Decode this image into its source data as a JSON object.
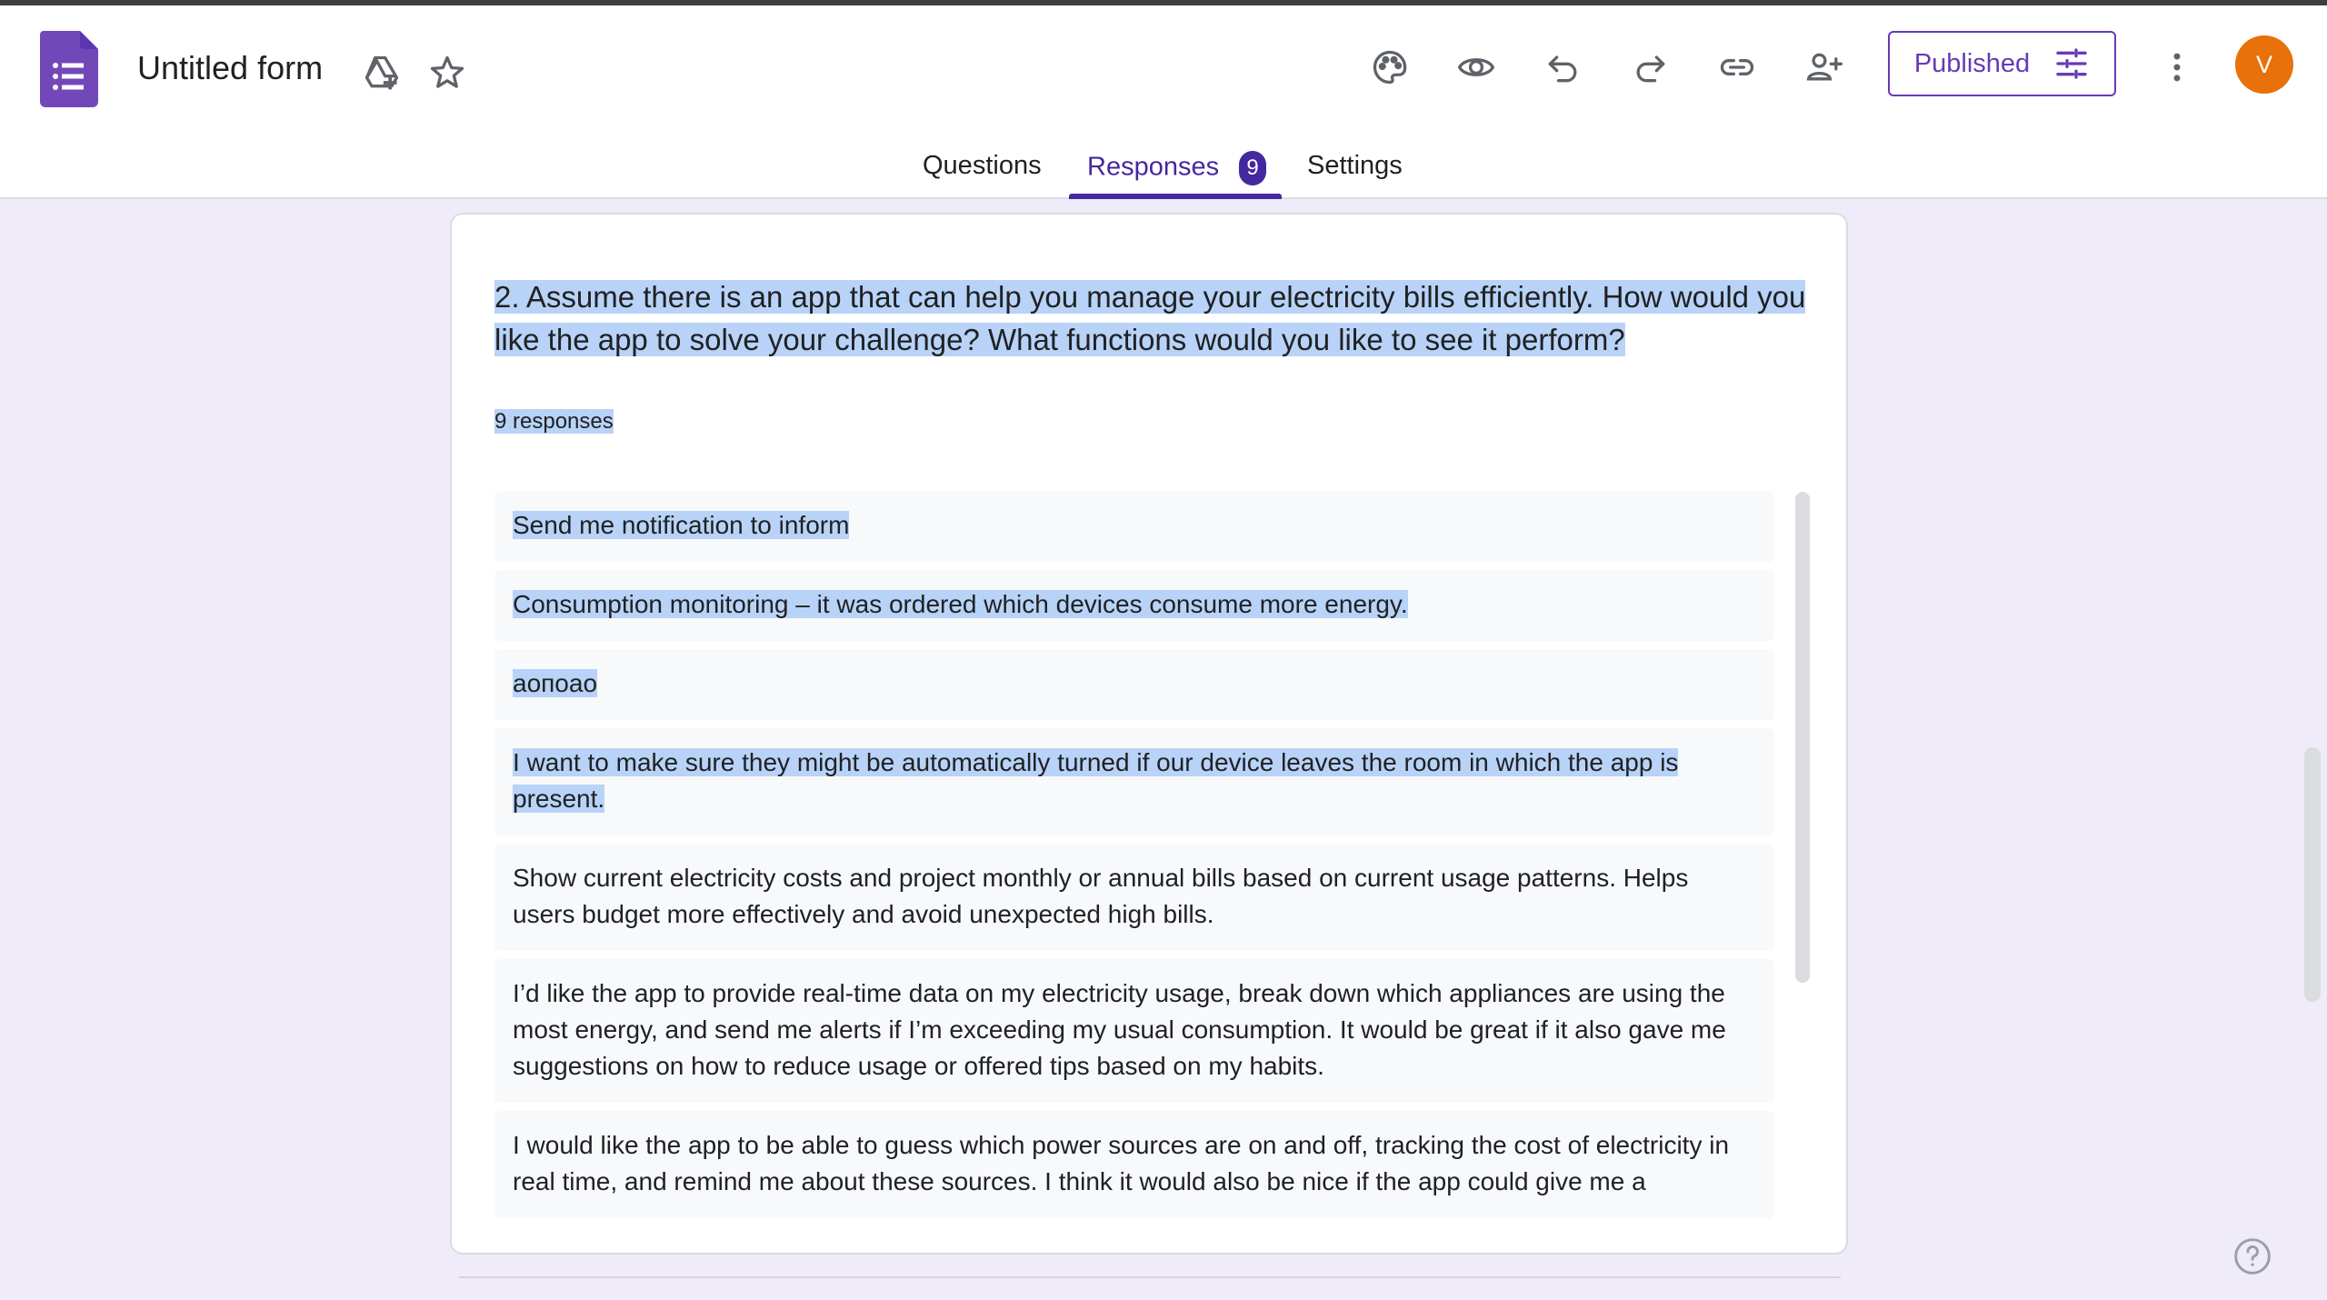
{
  "app": {
    "title": "Untitled form",
    "accent_color": "#673ab7",
    "icons": [
      "forms-logo-icon",
      "move-to-drive-icon",
      "star-icon",
      "palette-icon",
      "preview-eye-icon",
      "undo-icon",
      "redo-icon",
      "link-icon",
      "add-collaborator-icon",
      "more-vert-icon",
      "tune-icon",
      "help-icon"
    ]
  },
  "toolbar": {
    "published_label": "Published",
    "avatar_initial": "V",
    "avatar_color": "#e8710a"
  },
  "tabs": {
    "questions": "Questions",
    "responses": "Responses",
    "responses_count": "9",
    "settings": "Settings"
  },
  "question": {
    "text": "2. Assume there is an app that can help you manage your electricity bills efficiently. How would you like the app to solve your challenge? What functions would you like to see it perform?",
    "responses_label": "9 responses",
    "answers": [
      "Send me notification to inform",
      "Consumption monitoring – it was ordered which devices consume more energy.",
      "аопоао",
      "I want to make sure they might be automatically turned if our device leaves the room in which the app is present.",
      "Show current electricity costs and project monthly or annual bills based on current usage patterns. Helps users budget more effectively and avoid unexpected high bills.",
      "I’d like the app to provide real-time data on my electricity usage, break down which appliances are using the most energy, and send me alerts if I’m exceeding my usual consumption. It would be great if it also gave me suggestions on how to reduce usage or offered tips based on my habits.",
      "I would like the app to be able to guess which power sources are on and off, tracking the cost of electricity in real time, and remind me about these sources. I think it would also be nice if the app could give me a"
    ]
  }
}
